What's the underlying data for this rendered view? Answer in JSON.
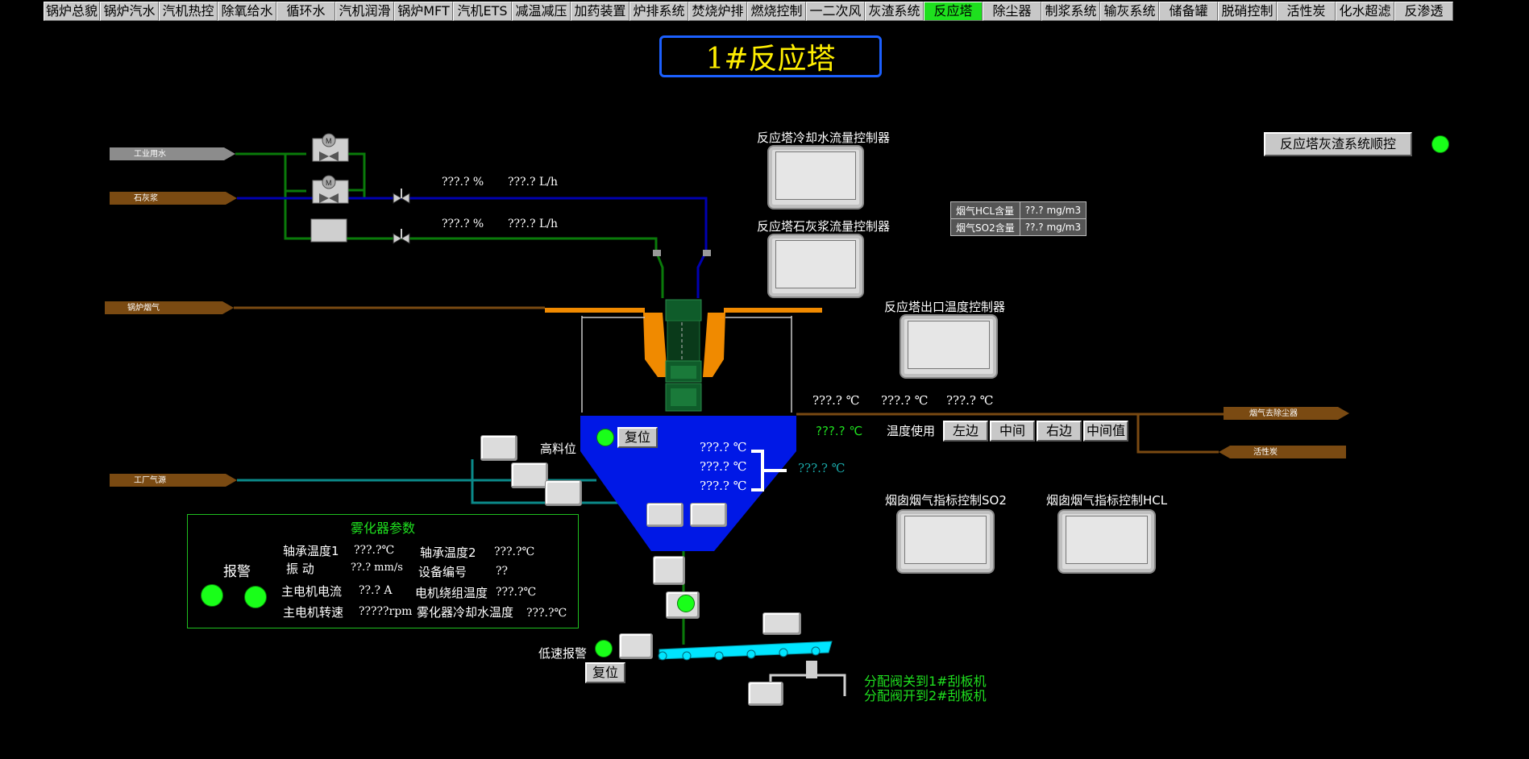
{
  "nav": {
    "items": [
      "锅炉总貌",
      "锅炉汽水",
      "汽机热控",
      "除氧给水",
      "循环水",
      "汽机润滑",
      "锅炉MFT",
      "汽机ETS",
      "减温减压",
      "加药装置",
      "炉排系统",
      "焚烧炉排",
      "燃烧控制",
      "一二次风",
      "灰渣系统",
      "反应塔",
      "除尘器",
      "制浆系统",
      "输灰系统",
      "储备罐",
      "脱硝控制",
      "活性炭",
      "化水超滤",
      "反渗透"
    ],
    "active_index": 15
  },
  "title": "1#反应塔",
  "sources": {
    "industrial_water": "工业用水",
    "lime_slurry": "石灰浆",
    "boiler_flue_gas": "锅炉烟气",
    "plant_gas": "工厂气源",
    "to_dust_collector": "烟气去除尘器",
    "activated_carbon": "活性炭"
  },
  "flow_readings": {
    "row1_pct": "???.? %",
    "row1_flow": "???.? L/h",
    "row2_pct": "???.? %",
    "row2_flow": "???.? L/h"
  },
  "controllers": {
    "cooling_water": "反应塔冷却水流量控制器",
    "lime_slurry": "反应塔石灰浆流量控制器",
    "outlet_temp": "反应塔出口温度控制器",
    "stack_so2": "烟囱烟气指标控制SO2",
    "stack_hcl": "烟囱烟气指标控制HCL"
  },
  "ash_sequence_button": "反应塔灰渣系统顺控",
  "gas_content": [
    {
      "label": "烟气HCL含量",
      "value": "??.? mg/m3"
    },
    {
      "label": "烟气SO2含量",
      "value": "??.? mg/m3"
    }
  ],
  "outlet_temps": [
    "???.? ℃",
    "???.? ℃",
    "???.? ℃"
  ],
  "outlet_avg_temp": "???.? ℃",
  "temp_use": {
    "label": "温度使用",
    "options": [
      "左边",
      "中间",
      "右边",
      "中间值"
    ]
  },
  "tower_temps": [
    "???.? ℃",
    "???.? ℃",
    "???.? ℃"
  ],
  "tower_avg_temp": "???.? ℃",
  "high_level_label": "高料位",
  "reset_label": "复位",
  "low_speed_label": "低速报警",
  "atomizer": {
    "title": "雾化器参数",
    "alarm_label": "报警",
    "bearing_temp1_label": "轴承温度1",
    "bearing_temp1_value": "???.?℃",
    "bearing_temp2_label": "轴承温度2",
    "bearing_temp2_value": "???.?℃",
    "vibration_label": "振  动",
    "vibration_value": "??.? mm/s",
    "device_id_label": "设备编号",
    "device_id_value": "??",
    "motor_current_label": "主电机电流",
    "motor_current_value": "??.? A",
    "winding_temp_label": "电机绕组温度",
    "winding_temp_value": "???.?℃",
    "motor_speed_label": "主电机转速",
    "motor_speed_value": "?????rpm",
    "cooling_temp_label": "雾化器冷却水温度",
    "cooling_temp_value": "???.?℃"
  },
  "distribution": {
    "to_scraper1": "分配阀关到1#刮板机",
    "to_scraper2": "分配阀开到2#刮板机"
  },
  "colors": {
    "active_nav": "#1ee01e",
    "title_text": "#ffee00",
    "title_border": "#1c60ff",
    "tower_blue": "#0018e6",
    "water_green": "#0a7a0a",
    "slurry_blue": "#0000b0",
    "flue_brown": "#7a4a12",
    "indicator_green": "#19ff19",
    "conveyor_cyan": "#00e5ff"
  }
}
